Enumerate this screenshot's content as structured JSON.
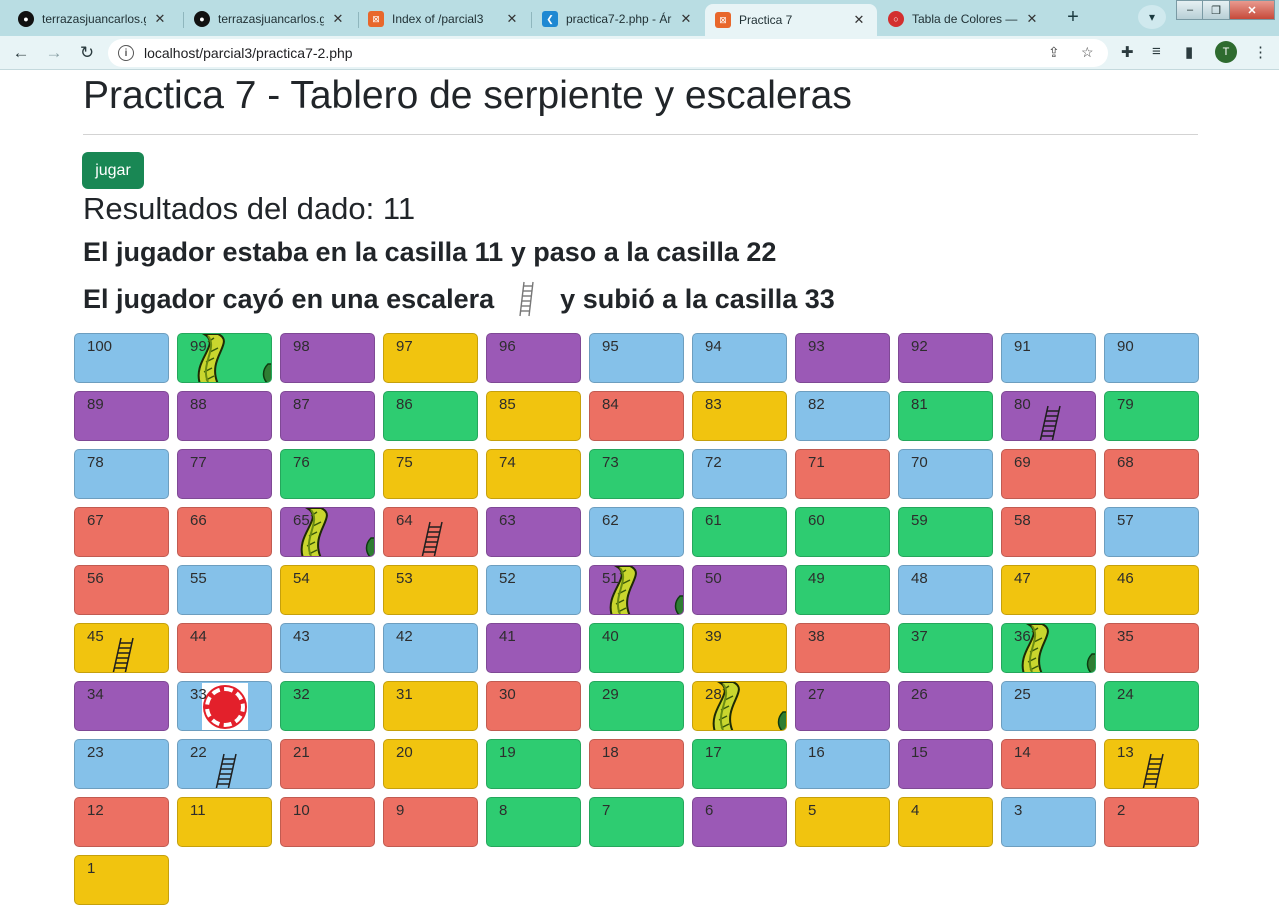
{
  "browser": {
    "tabs": [
      {
        "title": "terrazasjuancarlos.git",
        "icon": "github-icon",
        "active": false
      },
      {
        "title": "terrazasjuancarlos.git",
        "icon": "github-icon",
        "active": false
      },
      {
        "title": "Index of /parcial3",
        "icon": "xampp-icon",
        "active": false
      },
      {
        "title": "practica7-2.php - Ár",
        "icon": "vscode-icon",
        "active": false
      },
      {
        "title": "Practica 7",
        "icon": "xampp-icon",
        "active": true
      },
      {
        "title": "Tabla de Colores — C",
        "icon": "opera-icon",
        "active": false
      }
    ],
    "url": "localhost/parcial3/practica7-2.php",
    "profile_initial": "T"
  },
  "page": {
    "title": "Practica 7 - Tablero de serpiente y escaleras",
    "play_button": "jugar",
    "dice_result": "Resultados del dado: 11",
    "move_text": "El jugador estaba en la casilla 11 y paso a la casilla 22",
    "event_prefix": "El jugador cayó en una escalera",
    "event_suffix": "y subió a la casilla 33"
  },
  "board": {
    "rows": [
      [
        {
          "n": "100",
          "c": "blue"
        },
        {
          "n": "99",
          "c": "green",
          "img": "snake"
        },
        {
          "n": "98",
          "c": "purple"
        },
        {
          "n": "97",
          "c": "yellow"
        },
        {
          "n": "96",
          "c": "purple"
        },
        {
          "n": "95",
          "c": "blue"
        },
        {
          "n": "94",
          "c": "blue"
        },
        {
          "n": "93",
          "c": "purple"
        },
        {
          "n": "92",
          "c": "purple"
        },
        {
          "n": "91",
          "c": "blue"
        },
        {
          "n": "90",
          "c": "blue"
        }
      ],
      [
        {
          "n": "89",
          "c": "purple"
        },
        {
          "n": "88",
          "c": "purple"
        },
        {
          "n": "87",
          "c": "purple"
        },
        {
          "n": "86",
          "c": "green"
        },
        {
          "n": "85",
          "c": "yellow"
        },
        {
          "n": "84",
          "c": "red"
        },
        {
          "n": "83",
          "c": "yellow"
        },
        {
          "n": "82",
          "c": "blue"
        },
        {
          "n": "81",
          "c": "green"
        },
        {
          "n": "80",
          "c": "purple",
          "img": "ladder"
        },
        {
          "n": "79",
          "c": "green"
        }
      ],
      [
        {
          "n": "78",
          "c": "blue"
        },
        {
          "n": "77",
          "c": "purple"
        },
        {
          "n": "76",
          "c": "green"
        },
        {
          "n": "75",
          "c": "yellow"
        },
        {
          "n": "74",
          "c": "yellow"
        },
        {
          "n": "73",
          "c": "green"
        },
        {
          "n": "72",
          "c": "blue"
        },
        {
          "n": "71",
          "c": "red"
        },
        {
          "n": "70",
          "c": "blue"
        },
        {
          "n": "69",
          "c": "red"
        },
        {
          "n": "68",
          "c": "red"
        }
      ],
      [
        {
          "n": "67",
          "c": "red"
        },
        {
          "n": "66",
          "c": "red"
        },
        {
          "n": "65",
          "c": "purple",
          "img": "snake"
        },
        {
          "n": "64",
          "c": "red",
          "img": "ladder"
        },
        {
          "n": "63",
          "c": "purple"
        },
        {
          "n": "62",
          "c": "blue"
        },
        {
          "n": "61",
          "c": "green"
        },
        {
          "n": "60",
          "c": "green"
        },
        {
          "n": "59",
          "c": "green"
        },
        {
          "n": "58",
          "c": "red"
        },
        {
          "n": "57",
          "c": "blue"
        }
      ],
      [
        {
          "n": "56",
          "c": "red"
        },
        {
          "n": "55",
          "c": "blue"
        },
        {
          "n": "54",
          "c": "yellow"
        },
        {
          "n": "53",
          "c": "yellow"
        },
        {
          "n": "52",
          "c": "blue"
        },
        {
          "n": "51",
          "c": "purple",
          "img": "snake"
        },
        {
          "n": "50",
          "c": "purple"
        },
        {
          "n": "49",
          "c": "green"
        },
        {
          "n": "48",
          "c": "blue"
        },
        {
          "n": "47",
          "c": "yellow"
        },
        {
          "n": "46",
          "c": "yellow"
        }
      ],
      [
        {
          "n": "45",
          "c": "yellow",
          "img": "ladder"
        },
        {
          "n": "44",
          "c": "red"
        },
        {
          "n": "43",
          "c": "blue"
        },
        {
          "n": "42",
          "c": "blue"
        },
        {
          "n": "41",
          "c": "purple"
        },
        {
          "n": "40",
          "c": "green"
        },
        {
          "n": "39",
          "c": "yellow"
        },
        {
          "n": "38",
          "c": "red"
        },
        {
          "n": "37",
          "c": "green"
        },
        {
          "n": "36",
          "c": "green",
          "img": "snake"
        },
        {
          "n": "35",
          "c": "red"
        }
      ],
      [
        {
          "n": "34",
          "c": "purple"
        },
        {
          "n": "33",
          "c": "blue",
          "img": "token"
        },
        {
          "n": "32",
          "c": "green"
        },
        {
          "n": "31",
          "c": "yellow"
        },
        {
          "n": "30",
          "c": "red"
        },
        {
          "n": "29",
          "c": "green"
        },
        {
          "n": "28",
          "c": "yellow",
          "img": "snake"
        },
        {
          "n": "27",
          "c": "purple"
        },
        {
          "n": "26",
          "c": "purple"
        },
        {
          "n": "25",
          "c": "blue"
        },
        {
          "n": "24",
          "c": "green"
        }
      ],
      [
        {
          "n": "23",
          "c": "blue"
        },
        {
          "n": "22",
          "c": "blue",
          "img": "ladder"
        },
        {
          "n": "21",
          "c": "red"
        },
        {
          "n": "20",
          "c": "yellow"
        },
        {
          "n": "19",
          "c": "green"
        },
        {
          "n": "18",
          "c": "red"
        },
        {
          "n": "17",
          "c": "green"
        },
        {
          "n": "16",
          "c": "blue"
        },
        {
          "n": "15",
          "c": "purple"
        },
        {
          "n": "14",
          "c": "red"
        },
        {
          "n": "13",
          "c": "yellow",
          "img": "ladder"
        }
      ],
      [
        {
          "n": "12",
          "c": "red"
        },
        {
          "n": "11",
          "c": "yellow"
        },
        {
          "n": "10",
          "c": "red"
        },
        {
          "n": "9",
          "c": "red"
        },
        {
          "n": "8",
          "c": "green"
        },
        {
          "n": "7",
          "c": "green"
        },
        {
          "n": "6",
          "c": "purple"
        },
        {
          "n": "5",
          "c": "yellow"
        },
        {
          "n": "4",
          "c": "yellow"
        },
        {
          "n": "3",
          "c": "blue"
        },
        {
          "n": "2",
          "c": "red"
        }
      ],
      [
        {
          "n": "1",
          "c": "yellow"
        }
      ]
    ]
  }
}
